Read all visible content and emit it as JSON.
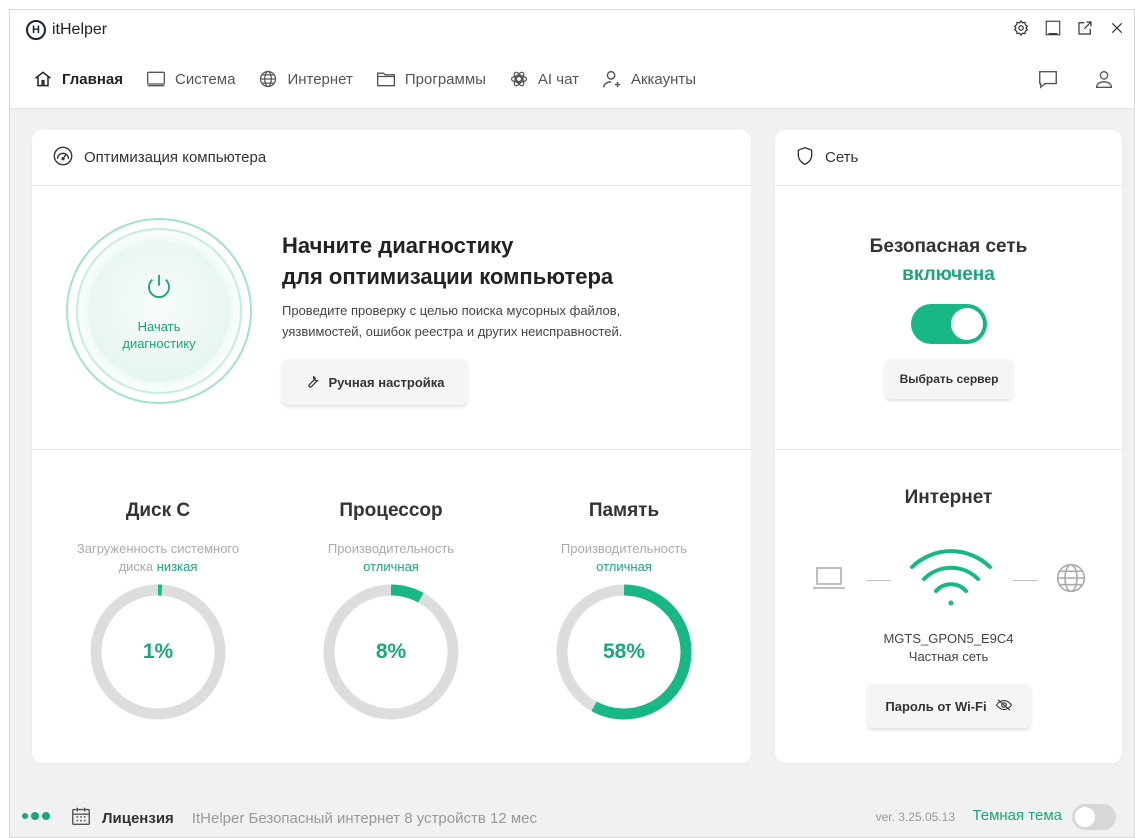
{
  "app": {
    "title": "itHelper",
    "logo_letter": "H"
  },
  "nav": {
    "items": [
      {
        "label": "Главная",
        "icon": "home-icon",
        "active": true
      },
      {
        "label": "Система",
        "icon": "monitor-icon"
      },
      {
        "label": "Интернет",
        "icon": "globe-icon"
      },
      {
        "label": "Программы",
        "icon": "folder-icon"
      },
      {
        "label": "AI чат",
        "icon": "ai-chat-icon"
      },
      {
        "label": "Аккаунты",
        "icon": "add-user-icon"
      }
    ]
  },
  "optimization": {
    "header": "Оптимизация компьютера",
    "start_label": "Начать диагностику",
    "title_line1": "Начните диагностику",
    "title_line2": "для оптимизации компьютера",
    "desc_line1": "Проведите проверку с целью поиска мусорных файлов,",
    "desc_line2": "уязвимостей, ошибок реестра и других неисправностей.",
    "manual_button": "Ручная настройка",
    "stats": [
      {
        "title": "Диск С",
        "sub_line1": "Загруженность системного",
        "sub_prefix": "диска ",
        "status": "низкая",
        "value": "1%",
        "fraction": 0.01
      },
      {
        "title": "Процессор",
        "sub_line1": "Производительность",
        "sub_prefix": "",
        "status": "отличная",
        "value": "8%",
        "fraction": 0.08
      },
      {
        "title": "Память",
        "sub_line1": "Производительность",
        "sub_prefix": "",
        "status": "отличная",
        "value": "58%",
        "fraction": 0.58
      }
    ]
  },
  "network": {
    "header": "Сеть",
    "title": "Безопасная сеть",
    "status": "включена",
    "toggle_on": true,
    "server_button": "Выбрать сервер",
    "internet_title": "Интернет",
    "ssid": "MGTS_GPON5_E9C4",
    "network_type": "Частная сеть",
    "wifi_button": "Пароль от Wi-Fi"
  },
  "footer": {
    "license_label": "Лицензия",
    "license_desc": "ItHelper Безопасный интернет 8 устройств 12 мес",
    "version": "ver. 3.25.05.13",
    "theme_label": "Темная тема",
    "dark_theme_on": false
  },
  "colors": {
    "accent": "#1aa77b",
    "toggle": "#17b886",
    "ring_track": "#dcdddf",
    "ring_fill": "#17b886"
  }
}
